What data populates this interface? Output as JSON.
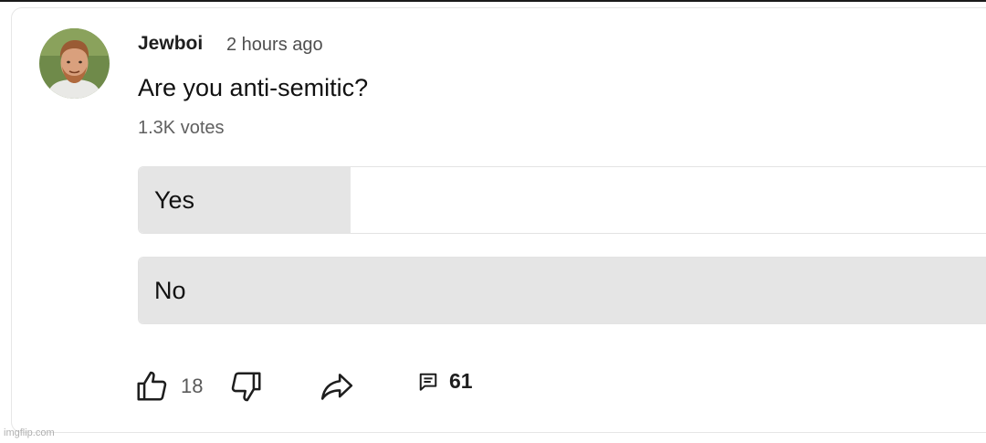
{
  "post": {
    "author": "Jewboi",
    "timestamp": "2 hours ago",
    "question": "Are you anti-semitic?",
    "votes": "1.3K votes",
    "avatar_icon": "user-avatar"
  },
  "poll": {
    "options": [
      {
        "label": "Yes",
        "share": 0.25
      },
      {
        "label": "No",
        "share": 1.0
      }
    ],
    "fill_color": "#e5e5e5"
  },
  "actions": {
    "like_count": "18",
    "comment_count": "61",
    "like_icon": "thumbs-up-icon",
    "dislike_icon": "thumbs-down-icon",
    "share_icon": "share-icon",
    "comment_icon": "comment-icon"
  },
  "watermark": "imgflip.com"
}
